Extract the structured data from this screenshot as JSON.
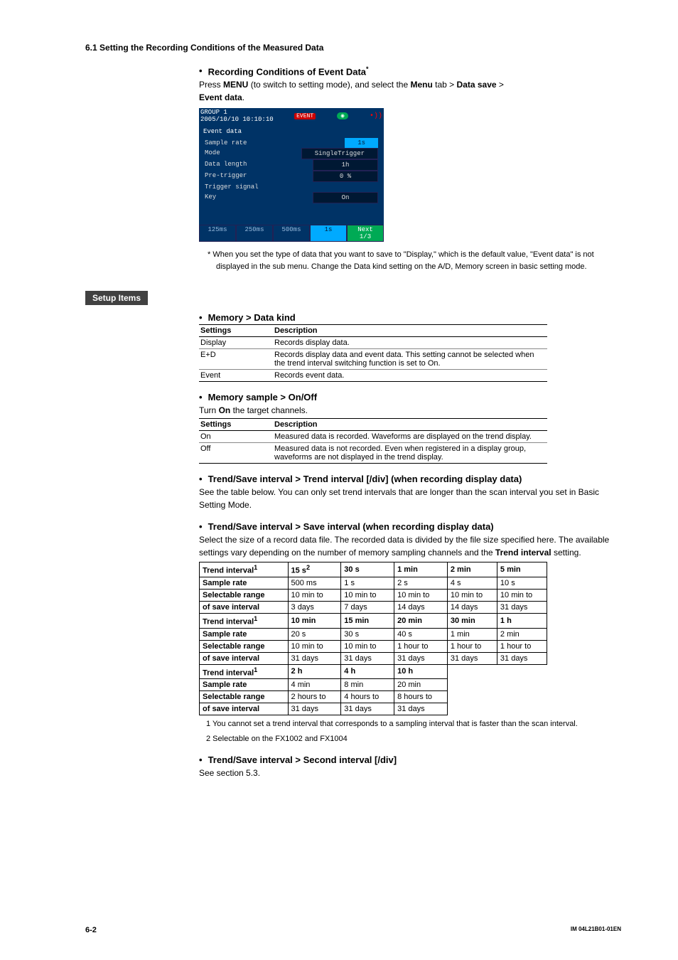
{
  "header": "6.1  Setting the Recording Conditions of the Measured Data",
  "rec_cond": {
    "title": "Recording Conditions of Event Data",
    "title_sup": "*",
    "para_pre": "Press ",
    "menu": "MENU",
    "para_mid": " (to switch to setting mode), and select the ",
    "menu_tab": "Menu",
    "para_tab": " tab > ",
    "data_save": "Data save",
    "para_gt": " > ",
    "event_data": "Event data",
    "para_end": "."
  },
  "screenshot": {
    "group": "GROUP 1",
    "time": "2005/10/10 10:10:10",
    "badge": "EVENT",
    "title": "Event data",
    "rows": [
      {
        "label": "Sample rate",
        "value": "1s",
        "hl": true
      },
      {
        "label": "Mode",
        "value": "SingleTrigger"
      },
      {
        "label": "Data length",
        "value": "1h"
      },
      {
        "label": "Pre-trigger",
        "value": "0      %"
      },
      {
        "label": "Trigger signal",
        "value": ""
      },
      {
        "label": "  Key",
        "value": "On"
      }
    ],
    "buttons": [
      "125ms",
      "250ms",
      "500ms",
      "1s",
      "Next 1/3"
    ]
  },
  "footnote_star": "*   When you set the type of data that you want to save to \"Display,\" which is the default value, \"Event data\" is not displayed in the sub menu. Change the Data kind setting on the A/D, Memory screen in basic setting mode.",
  "setup_items": "Setup Items",
  "mem_datakind": {
    "title": "Memory > Data kind",
    "h1": "Settings",
    "h2": "Description",
    "rows": [
      {
        "s": "Display",
        "d": "Records display data."
      },
      {
        "s": "E+D",
        "d": "Records display data and event data. This setting cannot be selected when the trend interval switching function is set to On."
      },
      {
        "s": "Event",
        "d": "Records event data."
      }
    ]
  },
  "mem_sample": {
    "title": "Memory sample > On/Off",
    "intro_a": "Turn ",
    "intro_b": "On",
    "intro_c": " the target channels.",
    "h1": "Settings",
    "h2": "Description",
    "rows": [
      {
        "s": "On",
        "d": "Measured data is recorded. Waveforms are displayed on the trend display."
      },
      {
        "s": "Off",
        "d": "Measured data is not recorded. Even when registered in a display group, waveforms are not displayed in the trend display."
      }
    ]
  },
  "trend_interval": {
    "title": "Trend/Save interval > Trend interval [/div] (when recording display data)",
    "body": "See the table below. You can only set trend intervals that are longer than the scan interval you set in Basic Setting Mode."
  },
  "save_interval": {
    "title": "Trend/Save interval > Save interval (when recording display data)",
    "body_a": "Select the size of a record data file. The recorded data is divided by the file size specified here. The available settings vary depending on the number of memory sampling channels and the ",
    "body_b": "Trend interval",
    "body_c": " setting."
  },
  "grid": {
    "row_labels": [
      "Trend interval",
      "Sample rate",
      "Selectable range of save interval"
    ],
    "sup1": "1",
    "sup2": "2",
    "blocks": [
      {
        "ti": "15 s",
        "sr": "500 ms",
        "rg": "10 min to 3 days",
        "ti_sup": "2"
      },
      {
        "ti": "30 s",
        "sr": "1 s",
        "rg": "10 min to 7 days"
      },
      {
        "ti": "1 min",
        "sr": "2 s",
        "rg": "10 min to 14 days"
      },
      {
        "ti": "2 min",
        "sr": "4 s",
        "rg": "10 min to 14 days"
      },
      {
        "ti": "5 min",
        "sr": "10 s",
        "rg": "10 min to 31 days"
      },
      {
        "ti": "10 min",
        "sr": "20 s",
        "rg": "10 min to 31 days"
      },
      {
        "ti": "15 min",
        "sr": "30 s",
        "rg": "10 min to 31 days"
      },
      {
        "ti": "20 min",
        "sr": "40 s",
        "rg": "1 hour to 31 days"
      },
      {
        "ti": "30 min",
        "sr": "1 min",
        "rg": "1 hour to 31 days"
      },
      {
        "ti": "1 h",
        "sr": "2 min",
        "rg": "1 hour to 31 days"
      },
      {
        "ti": "2 h",
        "sr": "4 min",
        "rg": "2 hours to 31 days"
      },
      {
        "ti": "4 h",
        "sr": "8 min",
        "rg": "4 hours to 31 days"
      },
      {
        "ti": "10 h",
        "sr": "20 min",
        "rg": "8 hours to 31 days"
      }
    ]
  },
  "grid_notes": {
    "n1": "1  You cannot set a trend interval that corresponds to a sampling interval that is faster than the scan interval.",
    "n2": "2  Selectable on the FX1002 and FX1004"
  },
  "second_interval": {
    "title": "Trend/Save interval > Second interval [/div]",
    "body": "See section 5.3."
  },
  "footer": {
    "page": "6-2",
    "doc": "IM 04L21B01-01EN"
  }
}
